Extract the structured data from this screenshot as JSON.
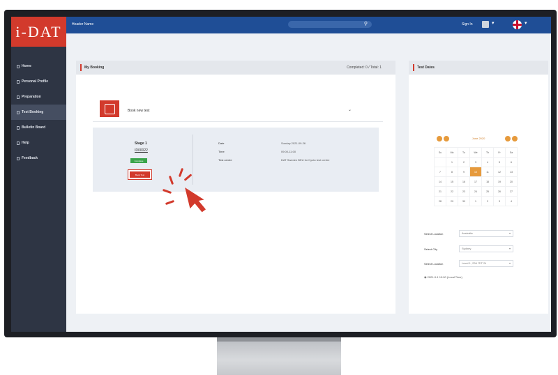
{
  "app": {
    "logo_text": "i-DAT",
    "user_name": "Header Name",
    "signin": "Sign In",
    "accent": "#d23a2c",
    "header_color": "#1f4e96"
  },
  "sidebar": {
    "items": [
      {
        "label": "Home",
        "icon": "home-icon",
        "active": false
      },
      {
        "label": "Personal Profile",
        "icon": "profile-icon",
        "active": false
      },
      {
        "label": "Preparation",
        "icon": "book-icon",
        "active": false
      },
      {
        "label": "Test Booking",
        "icon": "calendar-icon",
        "active": true
      },
      {
        "label": "Bulletin Board",
        "icon": "board-icon",
        "active": false
      },
      {
        "label": "Help",
        "icon": "help-icon",
        "active": false
      },
      {
        "label": "Feedback",
        "icon": "feedback-icon",
        "active": false
      }
    ]
  },
  "booking": {
    "title": "My Booking",
    "count": "Completed: 0 / Total: 1",
    "book_new": "Book new test",
    "stage": "Stage 1",
    "code": "ID00022",
    "complete_btn": "Complete",
    "book_btn": "Book Test",
    "details": [
      {
        "k": "Date",
        "v": "Sunday 2021-09-26"
      },
      {
        "k": "Time",
        "v": "09:00-11:00"
      },
      {
        "k": "Test centre",
        "v": "DAT Sweden BEU for Kyoto test centre"
      }
    ]
  },
  "dates": {
    "title": "Test Dates",
    "month": "June 2020",
    "weekdays": [
      "Su",
      "Mo",
      "Tu",
      "We",
      "Th",
      "Fr",
      "Sa"
    ],
    "weeks": [
      [
        "",
        "1",
        "2",
        "3",
        "4",
        "5",
        "6"
      ],
      [
        "7",
        "8",
        "9",
        "10",
        "11",
        "12",
        "13"
      ],
      [
        "14",
        "15",
        "16",
        "17",
        "18",
        "19",
        "20"
      ],
      [
        "21",
        "22",
        "23",
        "24",
        "25",
        "26",
        "27"
      ],
      [
        "28",
        "29",
        "30",
        "1",
        "2",
        "3",
        "4"
      ]
    ],
    "fields": [
      {
        "label": "Select Location",
        "value": "Australia"
      },
      {
        "label": "Select City",
        "value": "Sydney"
      },
      {
        "label": "Select Location",
        "value": "Level 1, 234 ITIT St"
      }
    ],
    "note": "2021-9-1 10:00 (Local Time)"
  }
}
